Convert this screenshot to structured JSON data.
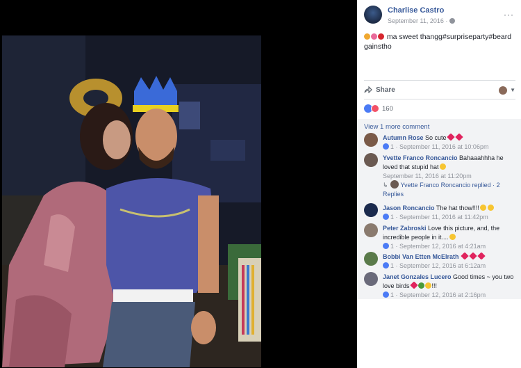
{
  "post": {
    "author": "Charlise Castro",
    "date": "September 11, 2016 ·",
    "more_label": "···",
    "caption_text": "ma sweet thangg#surpriseparty#beard gainstho",
    "caption_emojis": [
      "party-popper",
      "kiss-mark",
      "heart"
    ]
  },
  "actions": {
    "share_label": "Share",
    "caret": "▼"
  },
  "reactions": {
    "count": "160",
    "types": [
      "like",
      "love"
    ]
  },
  "comments": {
    "view_more": "View 1 more comment",
    "items": [
      {
        "name": "Autumn Rose",
        "text": "So cute",
        "trail": [
          "heart",
          "heart"
        ],
        "likes": "1",
        "time": "· September 11, 2016 at 10:06pm"
      },
      {
        "name": "Yvette Franco Roncancio",
        "text": "Bahaaahhha he loved that stupid hat",
        "trail": [
          "smiley"
        ],
        "likes": "",
        "time": "September 11, 2016 at 11:20pm"
      },
      {
        "name": "Jason Roncancio",
        "text": "The hat thow!!!!",
        "trail": [
          "smiley",
          "smiley"
        ],
        "likes": "1",
        "time": "· September 11, 2016 at 11:42pm"
      },
      {
        "name": "Peter Zabroski",
        "text": "Love this picture, and, the incredible people in it....",
        "trail": [
          "smiley"
        ],
        "likes": "1",
        "time": "· September 12, 2016 at 4:21am"
      },
      {
        "name": "Bobbi Van Etten McElrath",
        "text": "",
        "trail": [
          "heart",
          "heart",
          "heart"
        ],
        "likes": "1",
        "time": "· September 12, 2016 at 6:12am"
      },
      {
        "name": "Janet Gonzales Lucero",
        "text": "Good times ~ you two love birds",
        "trail": [
          "heart",
          "bottle",
          "clap"
        ],
        "trail_text": "!!!",
        "likes": "1",
        "time": "· September 12, 2016 at 2:16pm"
      }
    ],
    "reply": {
      "name": "Yvette Franco Roncancio",
      "label": "replied · 2 Replies"
    }
  },
  "colors": {
    "link": "#365899",
    "meta": "#90949c",
    "like_blue": "#4b7bf5",
    "love_red": "#f25268",
    "comment_bg": "#f2f3f5"
  }
}
